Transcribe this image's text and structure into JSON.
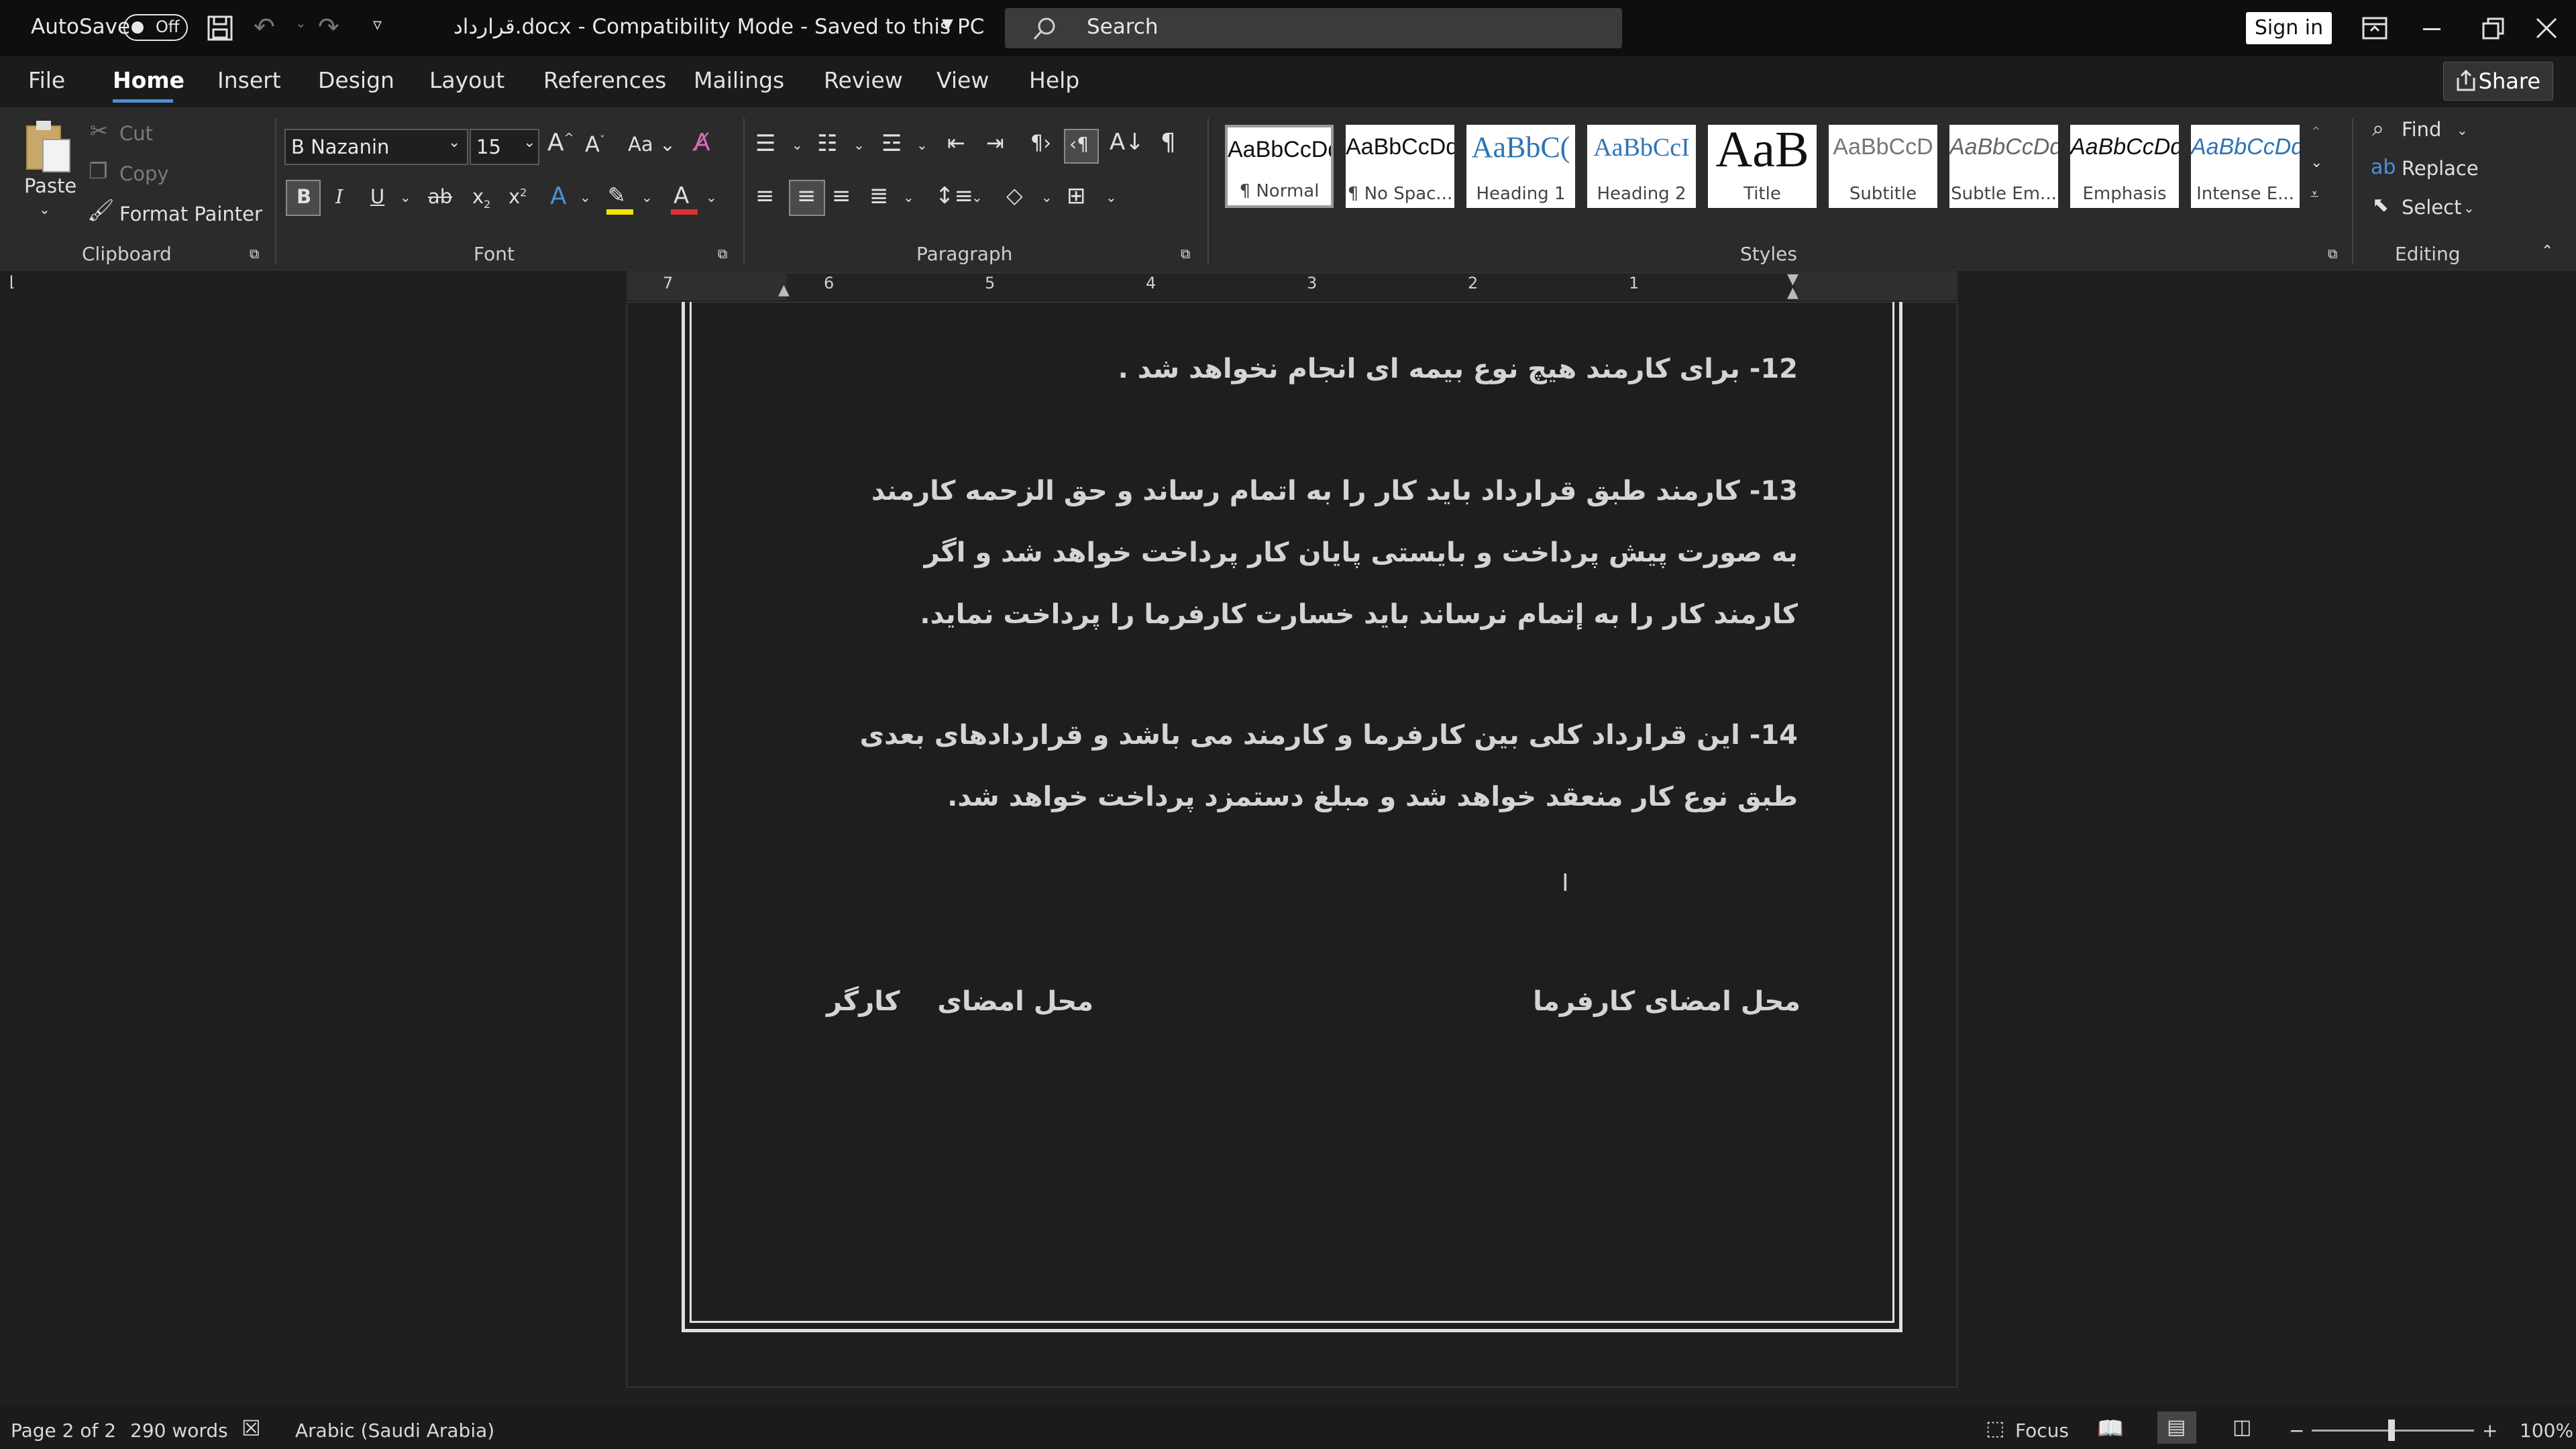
{
  "titlebar": {
    "autosave_label": "AutoSave",
    "autosave_state": "Off",
    "doc_title": "قرارداد.docx  -  Compatibility Mode  -  Saved to this PC",
    "search_placeholder": "Search",
    "signin_label": "Sign in"
  },
  "menu": {
    "tabs": [
      "File",
      "Home",
      "Insert",
      "Design",
      "Layout",
      "References",
      "Mailings",
      "Review",
      "View",
      "Help"
    ],
    "active_tab": "Home",
    "share_label": "Share"
  },
  "ribbon": {
    "clipboard": {
      "paste": "Paste",
      "cut": "Cut",
      "copy": "Copy",
      "format_painter": "Format Painter",
      "label": "Clipboard"
    },
    "font": {
      "font_name": "B Nazanin",
      "font_size": "15",
      "label": "Font",
      "case_label": "Aa"
    },
    "paragraph": {
      "label": "Paragraph"
    },
    "styles": {
      "label": "Styles",
      "items": [
        {
          "sample": "AaBbCcDd",
          "name": "¶ Normal"
        },
        {
          "sample": "AaBbCcDd",
          "name": "¶ No Spac..."
        },
        {
          "sample": "AaBbC(",
          "name": "Heading 1"
        },
        {
          "sample": "AaBbCcI",
          "name": "Heading 2"
        },
        {
          "sample": "AaB",
          "name": "Title"
        },
        {
          "sample": "AaBbCcD",
          "name": "Subtitle"
        },
        {
          "sample": "AaBbCcDd",
          "name": "Subtle Em..."
        },
        {
          "sample": "AaBbCcDd",
          "name": "Emphasis"
        },
        {
          "sample": "AaBbCcDd",
          "name": "Intense E..."
        }
      ]
    },
    "editing": {
      "find": "Find",
      "replace": "Replace",
      "select": "Select",
      "label": "Editing"
    }
  },
  "ruler": {
    "numbers": [
      "7",
      "6",
      "5",
      "4",
      "3",
      "2",
      "1"
    ]
  },
  "document": {
    "paragraphs": [
      "12- برای کارمند هیچ نوع بیمه ای انجام نخواهد شد .",
      "13- کارمند طبق قرارداد باید کار را به اتمام رساند و حق الزحمه کارمند به صورت پیش پرداخت و بایستی پایان کار پرداخت خواهد شد و اگر کارمند کار را به إتمام نرساند باید خسارت کارفرما را پرداخت نماید.",
      "14- این قرارداد کلی بین کارفرما و کارمند می باشد و قراردادهای بعدی طبق نوع کار منعقد خواهد شد و مبلغ دستمزد پرداخت خواهد شد."
    ],
    "signature_employer": "محل امضای کارفرما",
    "signature_worker": "محل امضای    کارگر"
  },
  "statusbar": {
    "page": "Page 2 of 2",
    "words": "290 words",
    "language": "Arabic (Saudi Arabia)",
    "focus": "Focus",
    "zoom": "100%"
  }
}
